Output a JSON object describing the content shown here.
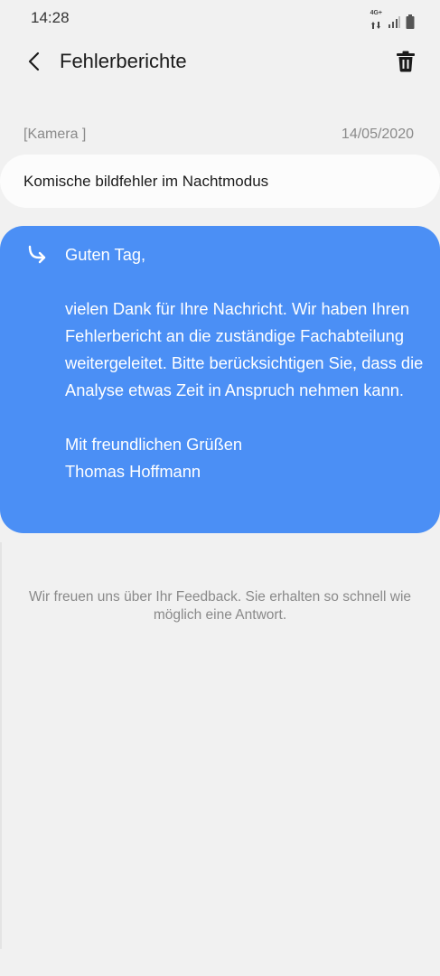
{
  "status": {
    "time": "14:28",
    "network_label": "4G+"
  },
  "header": {
    "title": "Fehlerberichte",
    "back_icon": "chevron-left-icon",
    "delete_icon": "trash-icon"
  },
  "report": {
    "category": "[Kamera  ]",
    "date": "14/05/2020",
    "user_message": "Komische bildfehler im Nachtmodus"
  },
  "reply": {
    "icon": "reply-arrow-icon",
    "greeting": "Guten Tag,",
    "body": "vielen Dank für Ihre Nachricht. Wir haben Ihren Fehlerbericht an die zuständige Fachabteilung weitergeleitet. Bitte berücksichtigen Sie, dass die Analyse etwas Zeit in Anspruch nehmen kann.",
    "closing": "Mit freundlichen Grüßen",
    "signature": "Thomas Hoffmann",
    "background_color": "#4b8ff5"
  },
  "footer": {
    "note": "Wir freuen uns über Ihr Feedback. Sie erhalten so schnell wie möglich eine Antwort."
  }
}
